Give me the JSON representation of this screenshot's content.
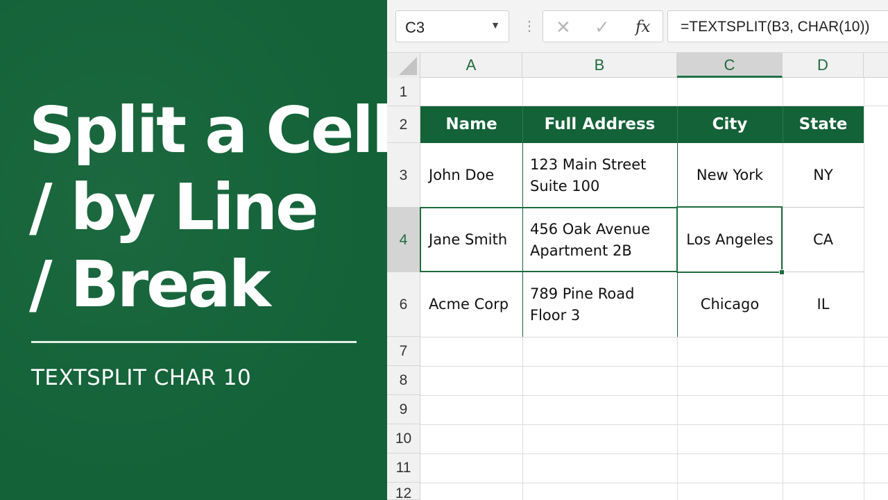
{
  "banner": {
    "title_lines": [
      "Split a Cell",
      "/ by Line",
      "/ Break"
    ],
    "subtitle": "TEXTSPLIT CHAR 10"
  },
  "formula_bar": {
    "name_box": "C3",
    "cancel_icon": "close-icon",
    "enter_icon": "check-icon",
    "fx_label": "fx",
    "formula": "=TEXTSPLIT(B3, CHAR(10))"
  },
  "columns": [
    "A",
    "B",
    "C",
    "D"
  ],
  "active_column": "C",
  "rows": [
    "1",
    "2",
    "3",
    "4",
    "6",
    "7",
    "8",
    "9",
    "10",
    "11",
    "12"
  ],
  "active_row": "4",
  "table": {
    "headers": [
      "Name",
      "Full Address",
      "City",
      "State"
    ],
    "records": [
      {
        "name": "John Doe",
        "address_line1": "123 Main Street",
        "address_line2": "Suite 100",
        "city": "New York",
        "state": "NY"
      },
      {
        "name": "Jane Smith",
        "address_line1": "456 Oak Avenue",
        "address_line2": "Apartment 2B",
        "city": "Los Angeles",
        "state": "CA"
      },
      {
        "name": "Acme Corp",
        "address_line1": "789 Pine Road",
        "address_line2": "Floor 3",
        "city": "Chicago",
        "state": "IL"
      }
    ]
  },
  "colors": {
    "banner_green": "#136238",
    "header_text_green": "#1e6b3d",
    "selection_green": "#1e6b3d"
  }
}
